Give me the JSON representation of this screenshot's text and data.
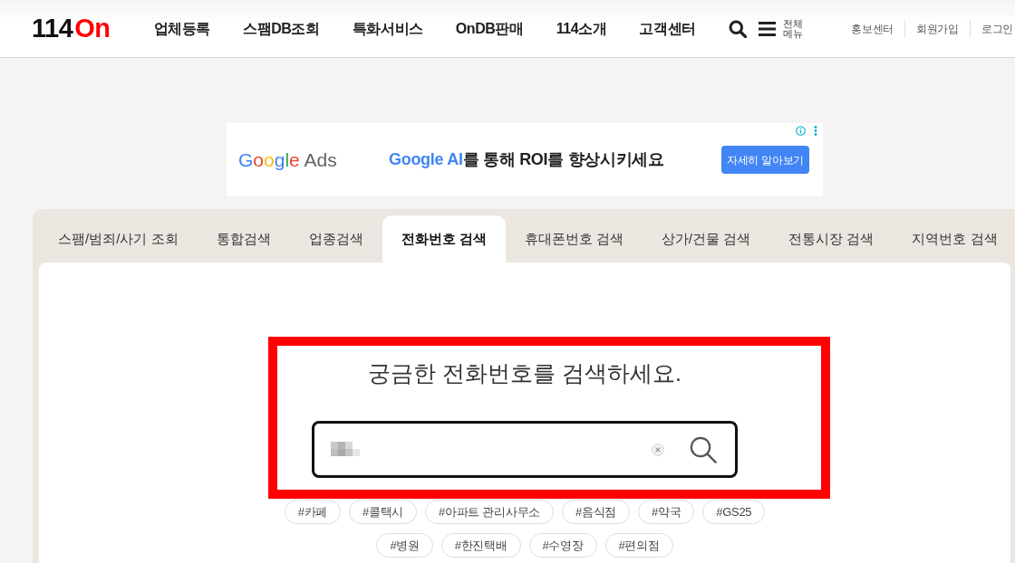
{
  "header": {
    "logo": [
      {
        "text": "114",
        "accent": false
      },
      {
        "text": "On",
        "accent": true
      }
    ],
    "nav": [
      "업체등록",
      "스팸DB조회",
      "특화서비스",
      "OnDB판매",
      "114소개",
      "고객센터"
    ],
    "all_menu_label": "전체 메뉴",
    "links": [
      "홍보센터",
      "회원가입",
      "로그인"
    ]
  },
  "ad": {
    "logo": "Google Ads",
    "headline": [
      {
        "text": "Google AI",
        "highlight": true
      },
      {
        "text": "를 통해 ROI를 향상시키세요",
        "highlight": false
      }
    ],
    "button": "자세히 알아보기"
  },
  "tabs": [
    {
      "label": "스팸/범죄/사기 조회",
      "selected": false
    },
    {
      "label": "통합검색",
      "selected": false
    },
    {
      "label": "업종검색",
      "selected": false
    },
    {
      "label": "전화번호 검색",
      "selected": true
    },
    {
      "label": "휴대폰번호 검색",
      "selected": false
    },
    {
      "label": "상가/건물 검색",
      "selected": false
    },
    {
      "label": "전통시장 검색",
      "selected": false
    },
    {
      "label": "지역번호 검색",
      "selected": false
    }
  ],
  "search": {
    "heading": "궁금한 전화번호를 검색하세요.",
    "value_blurred": true
  },
  "tags": [
    "#카페",
    "#콜택시",
    "#아파트 관리사무소",
    "#음식점",
    "#약국",
    "#GS25",
    "#병원",
    "#한진택배",
    "#수영장",
    "#편의점"
  ],
  "annotation": {
    "kind": "frame"
  }
}
